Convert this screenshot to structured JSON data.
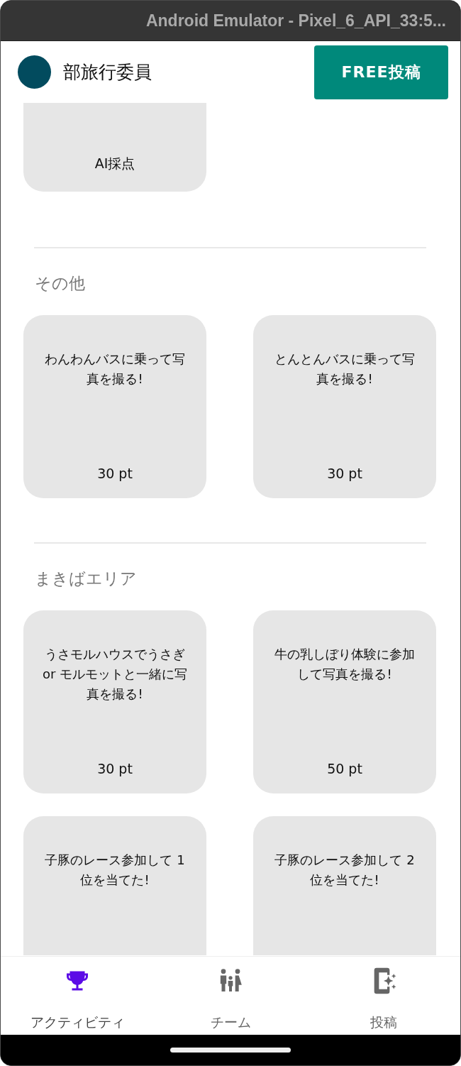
{
  "window": {
    "title": "Android Emulator - Pixel_6_API_33:5..."
  },
  "header": {
    "title": "部旅行委員",
    "button": "FREE投稿"
  },
  "top_card": {
    "footer": "AI採点"
  },
  "sections": [
    {
      "title": "その他",
      "cards": [
        {
          "title": "わんわんバスに乗って写真を撮る!",
          "points": "30 pt"
        },
        {
          "title": "とんとんバスに乗って写真を撮る!",
          "points": "30 pt"
        }
      ]
    },
    {
      "title": "まきばエリア",
      "cards": [
        {
          "title": "うさモルハウスでうさぎ or モルモットと一緒に写真を撮る!",
          "points": "30 pt"
        },
        {
          "title": "牛の乳しぼり体験に参加して写真を撮る!",
          "points": "50 pt"
        },
        {
          "title": "子豚のレース参加して 1 位を当てた!"
        },
        {
          "title": "子豚のレース参加して 2 位を当てた!"
        }
      ]
    }
  ],
  "nav": [
    {
      "label": "アクティビティ",
      "selected": true
    },
    {
      "label": "チーム",
      "selected": false
    },
    {
      "label": "投稿",
      "selected": false
    }
  ]
}
